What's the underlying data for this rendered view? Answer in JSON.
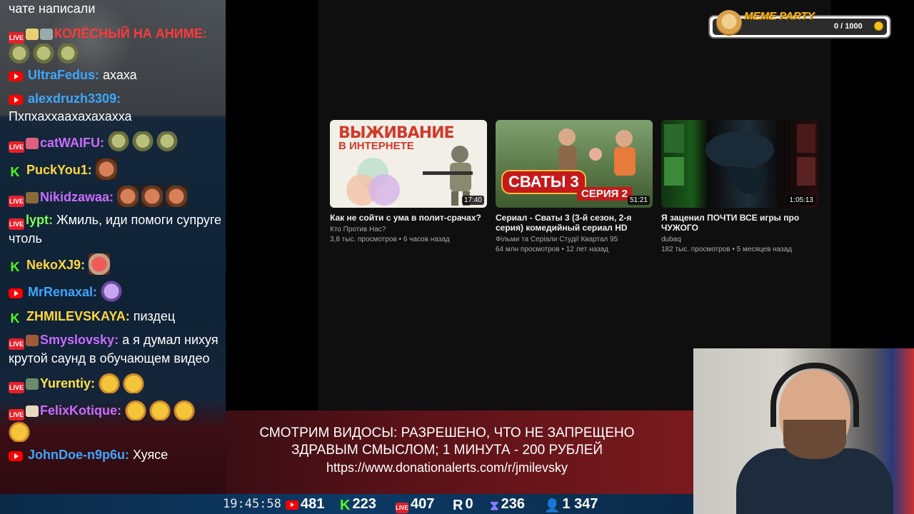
{
  "chat": {
    "messages": [
      {
        "name": "",
        "text": "чате написали"
      },
      {
        "name": "КОЛЁСНЫЙ НА АНИМЕ:",
        "text": ""
      },
      {
        "name": "UltraFedus:",
        "text": "ахаха"
      },
      {
        "name": "alexdruzh3309:",
        "text": "Пхпхаххаахахахахха"
      },
      {
        "name": "catWAIFU:",
        "text": ""
      },
      {
        "name": "PuckYou1:",
        "text": ""
      },
      {
        "name": "Nikidzawaa:",
        "text": ""
      },
      {
        "name": "lypt:",
        "text": "Жмиль, иди помоги супруге чтоль"
      },
      {
        "name": "NekoXJ9:",
        "text": ""
      },
      {
        "name": "MrRenaxal:",
        "text": ""
      },
      {
        "name": "ZHMILEVSKAYA:",
        "text": "пиздец"
      },
      {
        "name": "Smyslovsky:",
        "text": "а я думал нихуя крутой саунд в обучающем видео"
      },
      {
        "name": "Yurentiy:",
        "text": ""
      },
      {
        "name": "FelixKotique:",
        "text": ""
      },
      {
        "name": "JohnDoe-n9p6u:",
        "text": "Хуясе"
      }
    ]
  },
  "videos": [
    {
      "title": "Как не сойти с ума в полит-срачах?",
      "channel": "Кто Против Нас?",
      "meta": "3,8 тыс. просмотров • 6 часов назад",
      "duration": "17:40",
      "thumb_title": "ВЫЖИВАНИЕ",
      "thumb_sub": "В ИНТЕРНЕТЕ"
    },
    {
      "title": "Сериал - Сваты 3 (3-й сезон, 2-я серия) комедийный сериал HD",
      "channel": "Фільми та Серіали Студії Квартал 95",
      "meta": "64 млн просмотров • 12 лет назад",
      "duration": "51:21",
      "thumb_logo": "СВАТЫ 3",
      "thumb_ep": "СЕРИЯ 2"
    },
    {
      "title": "Я заценил ПОЧТИ ВСЕ игры про ЧУЖОГО",
      "channel": "dubaq",
      "meta": "182 тыс. просмотров • 5 месяцев назад",
      "duration": "1:05:13"
    }
  ],
  "meme_party": {
    "title": "MEME PARTY",
    "count": "0 / 1000"
  },
  "banner": {
    "line1": "СМОТРИМ ВИДОСЫ: РАЗРЕШЕНО, ЧТО НЕ ЗАПРЕЩЕНО",
    "line2": "ЗДРАВЫМ СМЫСЛОМ; 1 МИНУТА - 200 РУБЛЕЙ",
    "url": "https://www.donationalerts.com/r/jmilevsky"
  },
  "status": {
    "time": "19:45:58",
    "youtube": "481",
    "kick": "223",
    "vk": "407",
    "rutube_label": "R",
    "rutube": "0",
    "other": "236",
    "total": "1 347"
  },
  "colors": {
    "youtube_name": "#3ea6ff",
    "kick_name": "#ffd740",
    "vk_name": "#c86cff",
    "highlight_name": "#ff3a3a",
    "live_badge": "#e4212b",
    "kick_green": "#53fc18",
    "yellow_name": "#ffe14a",
    "green_name": "#7cff5a"
  }
}
